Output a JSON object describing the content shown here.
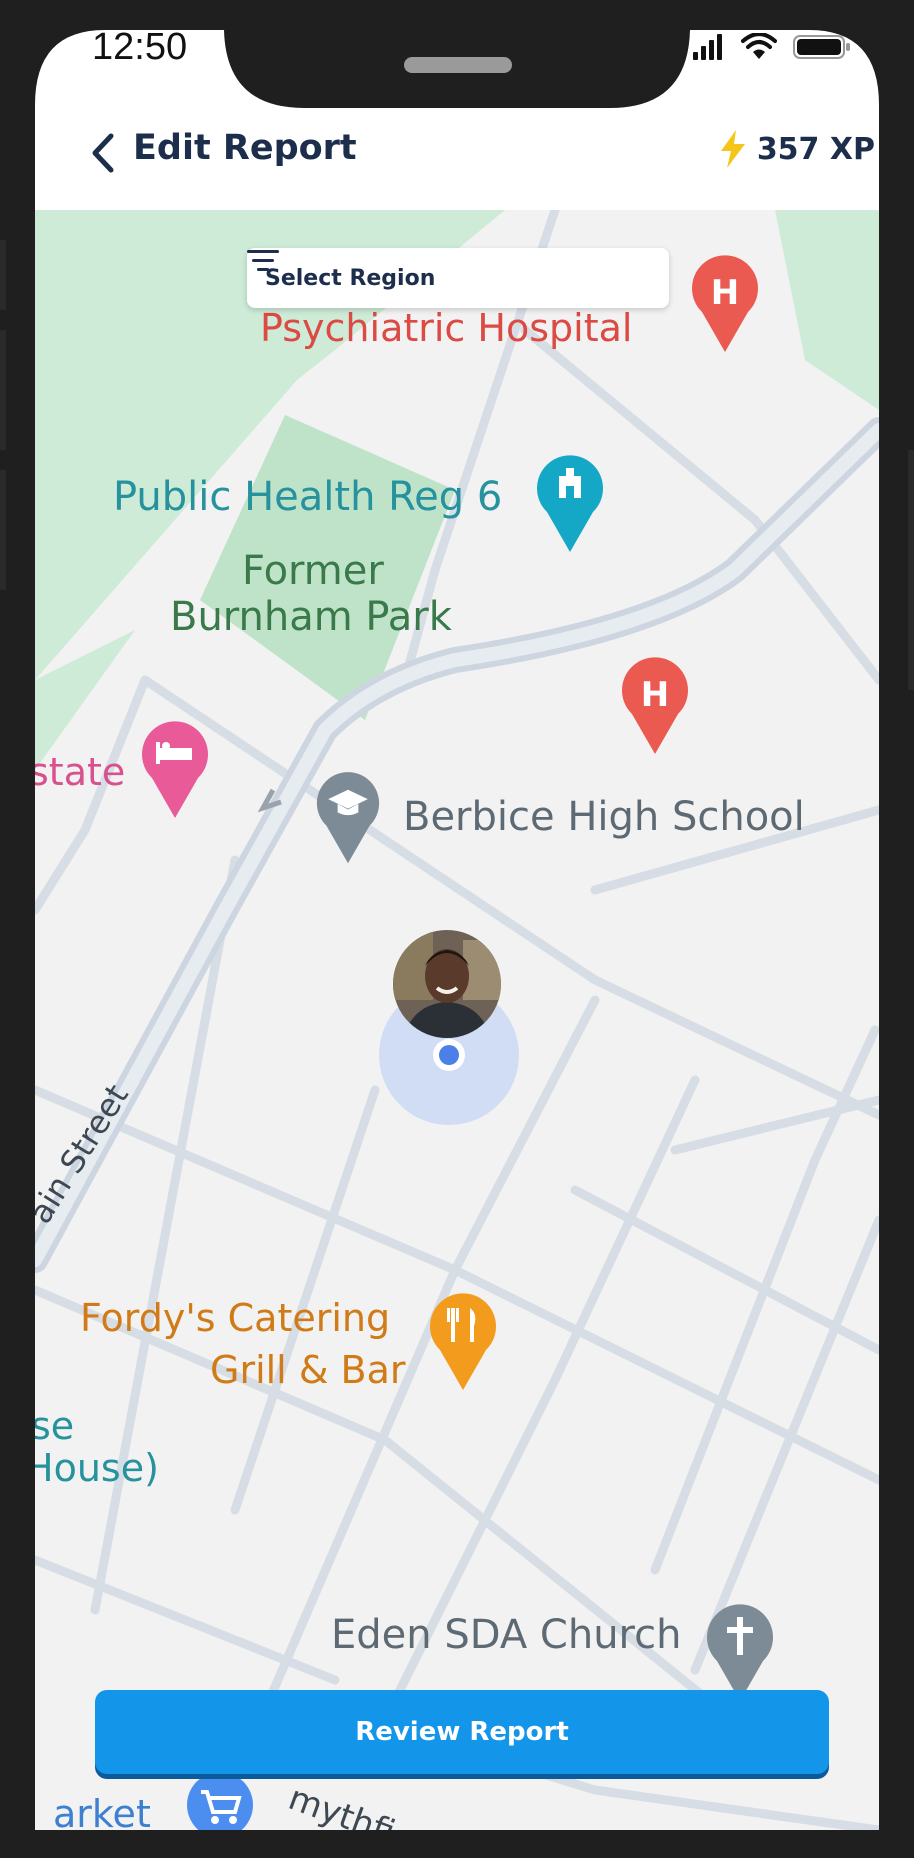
{
  "status_bar": {
    "time": "12:50"
  },
  "header": {
    "title": "Edit Report",
    "xp": "357 XP"
  },
  "map": {
    "select_region": "Select Region",
    "labels": {
      "psychiatric_hospital": "Psychiatric Hospital",
      "public_health": "Public Health Reg 6",
      "burnham_park_line1": "Former",
      "burnham_park_line2": "Burnham Park",
      "estate": "state",
      "berbice_high_school": "Berbice High School",
      "main_street": "ain Street",
      "fordys_line1": "Fordy's Catering",
      "fordys_line2": "Grill & Bar",
      "house_line1": "se",
      "house_line2": "House)",
      "eden_church": "Eden SDA Church",
      "market": "arket",
      "smythfield": "mythfi"
    }
  },
  "review_button": {
    "label": "Review Report"
  },
  "colors": {
    "accent": "#1395ea",
    "title": "#1d2e4d",
    "map_bg": "#f2f2f2",
    "park": "#cdebd7",
    "road": "#d6dde5"
  }
}
